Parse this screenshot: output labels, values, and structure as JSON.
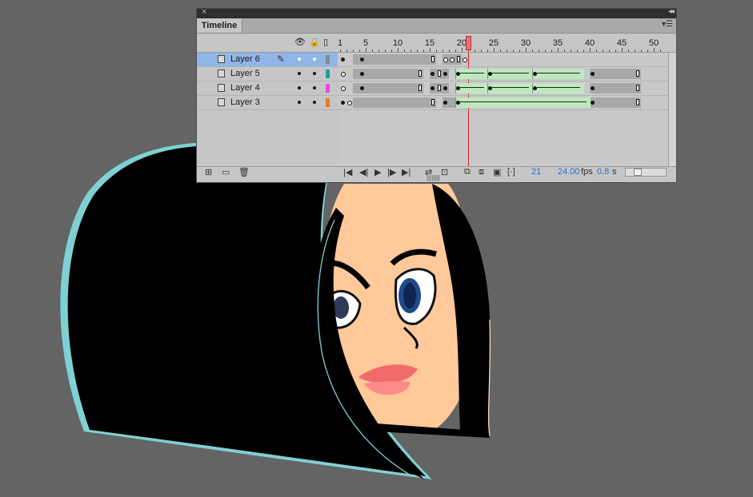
{
  "panel": {
    "title_tab": "Timeline",
    "ruler_labels": [
      "1",
      "5",
      "10",
      "15",
      "20",
      "25",
      "30",
      "35",
      "40",
      "45",
      "50"
    ],
    "current_frame_marker": "20"
  },
  "layers": [
    {
      "name": "Layer 6",
      "color": "#888888",
      "selected": true
    },
    {
      "name": "Layer 5",
      "color": "#1aa59a",
      "selected": false
    },
    {
      "name": "Layer 4",
      "color": "#e54ce0",
      "selected": false
    },
    {
      "name": "Layer 3",
      "color": "#f07a1e",
      "selected": false
    }
  ],
  "status": {
    "current_frame": "21",
    "frame_rate": "24.00",
    "fps_unit": "fps",
    "elapsed_time": "0.8",
    "time_unit": "s"
  },
  "icons": {
    "close": "×",
    "collapse": "◂◂",
    "panel_menu": "▾☰",
    "eye": "👁",
    "lock": "🔒",
    "outline": "▯",
    "pencil": "✎",
    "new_layer": "⊞",
    "new_folder": "▭",
    "delete": "🗑",
    "first_frame": "|◀",
    "step_back": "◀|",
    "play": "▶",
    "step_forward": "|▶",
    "last_frame": "▶|",
    "loop": "⇄",
    "center": "⊡",
    "onion_skin": "⧉",
    "onion_outline": "⧈",
    "edit_multiple": "▣",
    "modify_markers": "[·]"
  }
}
